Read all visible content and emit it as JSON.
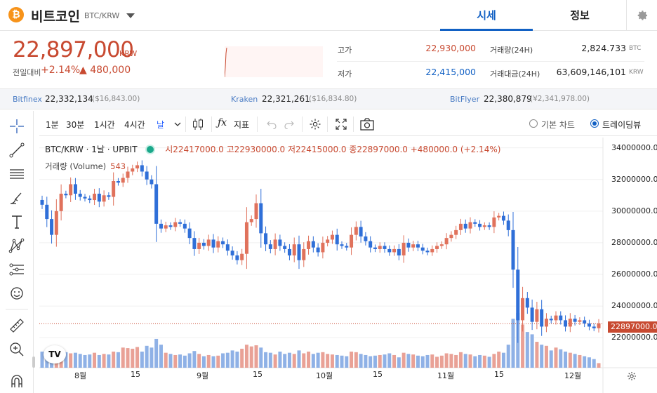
{
  "header": {
    "coin_symbol": "₿",
    "coin_name": "비트코인",
    "pair": "BTC/KRW",
    "tabs": [
      {
        "label": "시세",
        "active": true
      },
      {
        "label": "정보",
        "active": false
      }
    ]
  },
  "summary": {
    "price": "22,897,000",
    "unit": "KRW",
    "change_label": "전일대비",
    "change_pct": "+2.14%",
    "change_abs": "▲ 480,000",
    "stats": [
      {
        "label": "고가",
        "value": "22,930,000",
        "color": "#c84a31"
      },
      {
        "label": "저가",
        "value": "22,415,000",
        "color": "#1261c4"
      },
      {
        "label": "거래량(24H)",
        "value": "2,824.733",
        "unit": "BTC"
      },
      {
        "label": "거래대금(24H)",
        "value": "63,609,146,101",
        "unit": "KRW"
      }
    ]
  },
  "exchanges": [
    {
      "name": "Bitfinex",
      "krw": "22,332,134",
      "quote": "($16,843.00)"
    },
    {
      "name": "Kraken",
      "krw": "22,321,261",
      "quote": "($16,834.80)"
    },
    {
      "name": "BitFlyer",
      "krw": "22,380,879",
      "quote": "(¥2,341,978.00)"
    }
  ],
  "toolbar": {
    "intervals": [
      "1분",
      "30분",
      "1시간",
      "4시간",
      "날"
    ],
    "indicator_label": "지표",
    "chart_modes": [
      {
        "label": "기본 차트",
        "selected": false
      },
      {
        "label": "트레이딩뷰",
        "selected": true
      }
    ]
  },
  "icons": [
    "crosshair-icon",
    "trendline-icon",
    "fib-icon",
    "brush-icon",
    "text-icon",
    "pattern-icon",
    "prediction-icon",
    "emoji-icon",
    "ruler-icon",
    "zoom-in-icon",
    "magnet-icon",
    "gear-icon",
    "camera-icon",
    "fullscreen-icon",
    "undo-icon",
    "redo-icon"
  ],
  "chart_legend": {
    "symbol": "BTC/KRW · 1날 · UPBIT",
    "ohlc": "시22417000.0 고22930000.0 저22415000.0 종22897000.0 +480000.0 (+2.14%)",
    "volume_label": "거래량 (Volume)",
    "volume_value": "543"
  },
  "colors": {
    "up": "#e0725c",
    "down": "#2f6fd8",
    "vol_up": "#e9a196",
    "vol_down": "#8fb1e6",
    "accent": "#1261c4"
  },
  "chart_data": {
    "type": "candlestick",
    "current_price_label": "22897000.0",
    "y_ticks": [
      "34000000.0",
      "32000000.0",
      "30000000.0",
      "28000000.0",
      "26000000.0",
      "24000000.0",
      "22000000.0"
    ],
    "x_ticks": [
      "8월",
      "15",
      "9월",
      "15",
      "10월",
      "15",
      "11월",
      "15",
      "12월"
    ],
    "ylim": [
      20100000,
      34650000
    ],
    "closes": [
      30400000,
      29500000,
      28500000,
      30000000,
      31100000,
      31000000,
      31700000,
      31100000,
      30900000,
      30800000,
      30700000,
      31100000,
      30600000,
      31000000,
      30900000,
      31900000,
      31800000,
      32100000,
      32500000,
      32700000,
      32900000,
      32500000,
      32000000,
      31700000,
      29200000,
      28900000,
      29100000,
      29000000,
      29300000,
      29200000,
      28900000,
      28300000,
      27600000,
      28000000,
      27800000,
      28200000,
      27700000,
      28100000,
      27900000,
      27500000,
      27200000,
      26900000,
      27300000,
      29300000,
      29500000,
      30500000,
      28600000,
      27900000,
      27600000,
      28200000,
      27800000,
      27600000,
      27200000,
      27900000,
      26900000,
      27600000,
      28100000,
      27700000,
      27400000,
      28000000,
      28200000,
      28500000,
      27900000,
      27800000,
      27700000,
      28500000,
      29000000,
      28400000,
      28100000,
      27700000,
      27600000,
      27800000,
      27600000,
      27400000,
      27600000,
      27200000,
      28000000,
      27700000,
      27900000,
      27700000,
      27500000,
      27400000,
      27600000,
      27800000,
      27900000,
      28300000,
      28500000,
      28800000,
      29200000,
      28900000,
      29300000,
      29200000,
      29000000,
      29100000,
      29000000,
      29600000,
      29700000,
      29400000,
      28800000,
      26300000,
      23100000,
      24500000,
      23900000,
      23000000,
      23800000,
      22700000,
      23200000,
      23100000,
      23400000,
      23100000,
      22700000,
      23200000,
      23000000,
      23100000,
      22900000,
      22700000,
      22600000,
      22900000
    ],
    "volumes": [
      28,
      25,
      32,
      38,
      30,
      27,
      25,
      26,
      24,
      22,
      23,
      26,
      22,
      24,
      23,
      28,
      27,
      35,
      34,
      33,
      36,
      28,
      38,
      35,
      50,
      40,
      26,
      24,
      22,
      23,
      21,
      25,
      29,
      24,
      20,
      22,
      20,
      21,
      25,
      26,
      30,
      28,
      33,
      40,
      37,
      39,
      35,
      27,
      26,
      23,
      28,
      24,
      26,
      24,
      30,
      25,
      28,
      24,
      26,
      27,
      24,
      23,
      22,
      21,
      20,
      28,
      27,
      24,
      22,
      20,
      21,
      22,
      23,
      25,
      22,
      18,
      26,
      24,
      23,
      21,
      20,
      22,
      23,
      19,
      21,
      25,
      24,
      22,
      27,
      24,
      23,
      20,
      22,
      21,
      19,
      24,
      28,
      26,
      40,
      85,
      95,
      75,
      62,
      58,
      45,
      40,
      38,
      30,
      35,
      32,
      28,
      26,
      24,
      22,
      20,
      18,
      15,
      8
    ],
    "volume_scale": "relative"
  }
}
